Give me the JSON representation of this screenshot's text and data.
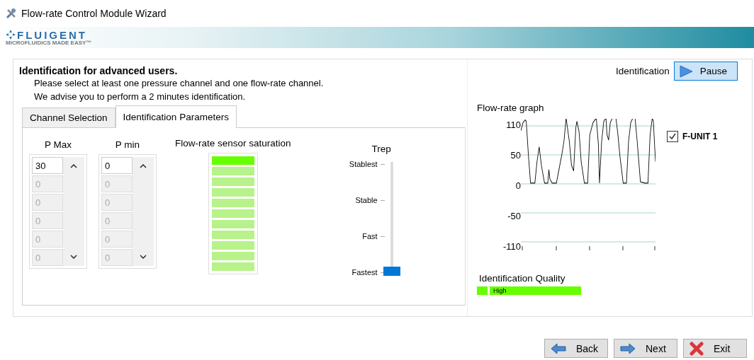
{
  "window": {
    "title": "Flow-rate Control Module Wizard"
  },
  "banner": {
    "logo": "FLUIGENT",
    "tagline": "MICROFLUIDICS MADE EASY™"
  },
  "heading": "Identification for advanced users.",
  "instructions": [
    "Please select at least one pressure  channel and one flow-rate channel.",
    "We advise you to perform a 2 minutes identification."
  ],
  "identification": {
    "label": "Identification",
    "button": "Pause"
  },
  "tabs": [
    {
      "label": "Channel Selection",
      "selected": false
    },
    {
      "label": "Identification Parameters",
      "selected": true
    }
  ],
  "spin_lists": [
    {
      "title": "P Max",
      "items": [
        {
          "value": "30",
          "disabled": false
        },
        {
          "value": "0",
          "disabled": true
        },
        {
          "value": "0",
          "disabled": true
        },
        {
          "value": "0",
          "disabled": true
        },
        {
          "value": "0",
          "disabled": true
        },
        {
          "value": "0",
          "disabled": true
        }
      ]
    },
    {
      "title": "P min",
      "items": [
        {
          "value": "0",
          "disabled": false
        },
        {
          "value": "0",
          "disabled": true
        },
        {
          "value": "0",
          "disabled": true
        },
        {
          "value": "0",
          "disabled": true
        },
        {
          "value": "0",
          "disabled": true
        },
        {
          "value": "0",
          "disabled": true
        }
      ]
    }
  ],
  "saturation": {
    "title": "Flow-rate sensor saturation",
    "level": 0.09
  },
  "trep": {
    "title": "Trep",
    "ticks": [
      "Stablest",
      "Stable",
      "Fast",
      "Fastest"
    ],
    "level": 0
  },
  "graph": {
    "title": "Flow-rate graph",
    "y_labels": [
      "110",
      "50",
      "0",
      "-50",
      "-110"
    ],
    "legend": {
      "label": "F-UNIT 1",
      "checked": true
    }
  },
  "quality": {
    "title": "Identification Quality",
    "value": "High"
  },
  "buttons": [
    {
      "label": "Back",
      "kind": "back"
    },
    {
      "label": "Next",
      "kind": "next"
    },
    {
      "label": "Exit",
      "kind": "exit"
    }
  ]
}
